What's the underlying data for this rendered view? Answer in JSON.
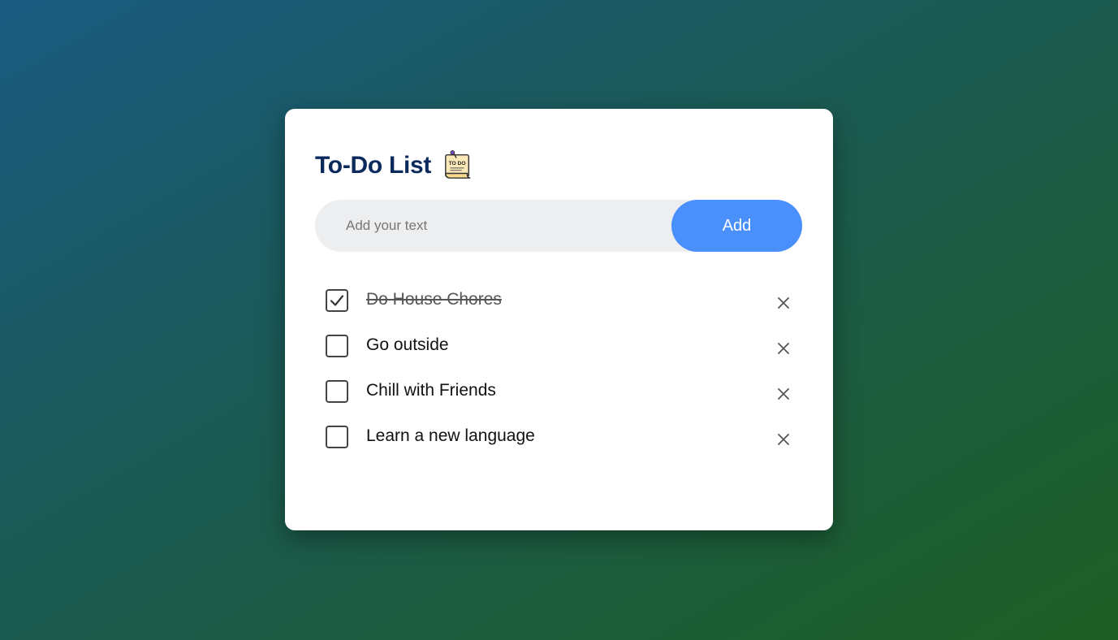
{
  "header": {
    "title": "To-Do List",
    "icon": "todo-note-icon",
    "icon_text": "TO DO"
  },
  "input": {
    "placeholder": "Add your text",
    "value": "",
    "add_label": "Add"
  },
  "todos": [
    {
      "text": "Do House Chores",
      "checked": true
    },
    {
      "text": "Go outside",
      "checked": false
    },
    {
      "text": "Chill with Friends",
      "checked": false
    },
    {
      "text": "Learn a new language",
      "checked": false
    }
  ],
  "colors": {
    "accent": "#4a90fd",
    "title": "#0b2a5c",
    "input_bg": "#edeef0"
  }
}
